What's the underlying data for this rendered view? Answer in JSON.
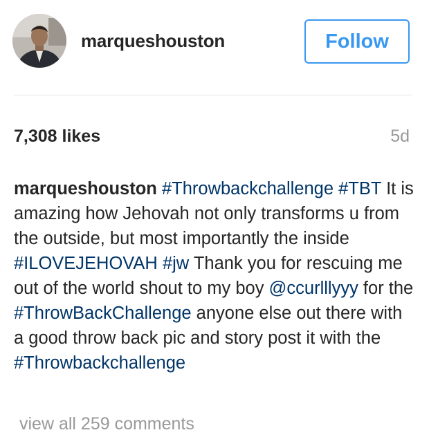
{
  "header": {
    "username": "marqueshouston",
    "follow_label": "Follow"
  },
  "post": {
    "likes": "7,308 likes",
    "time_ago": "5d",
    "caption": {
      "author": "marqueshouston",
      "hashtag_1": "#Throwbackchallenge",
      "hashtag_2": "#TBT",
      "text_1": " It is amazing how Jehovah not only transforms u from the outside, but most importantly the inside ",
      "hashtag_3": "#ILOVEJEHOVAH",
      "hashtag_4": "#jw",
      "text_2": " Thank you for rescuing me out of the world shout to my boy ",
      "mention_1": "@ccurlllyyy",
      "text_3": " for the ",
      "hashtag_5": "#ThrowBackChallenge",
      "text_4": " anyone else out there with a good throw back pic and story post it with the ",
      "hashtag_6": "#Throwbackchallenge"
    },
    "view_comments": "view all 259 comments"
  },
  "colors": {
    "link_blue": "#003569",
    "follow_blue": "#3897f0",
    "muted_gray": "#999999",
    "text_dark": "#262626"
  }
}
